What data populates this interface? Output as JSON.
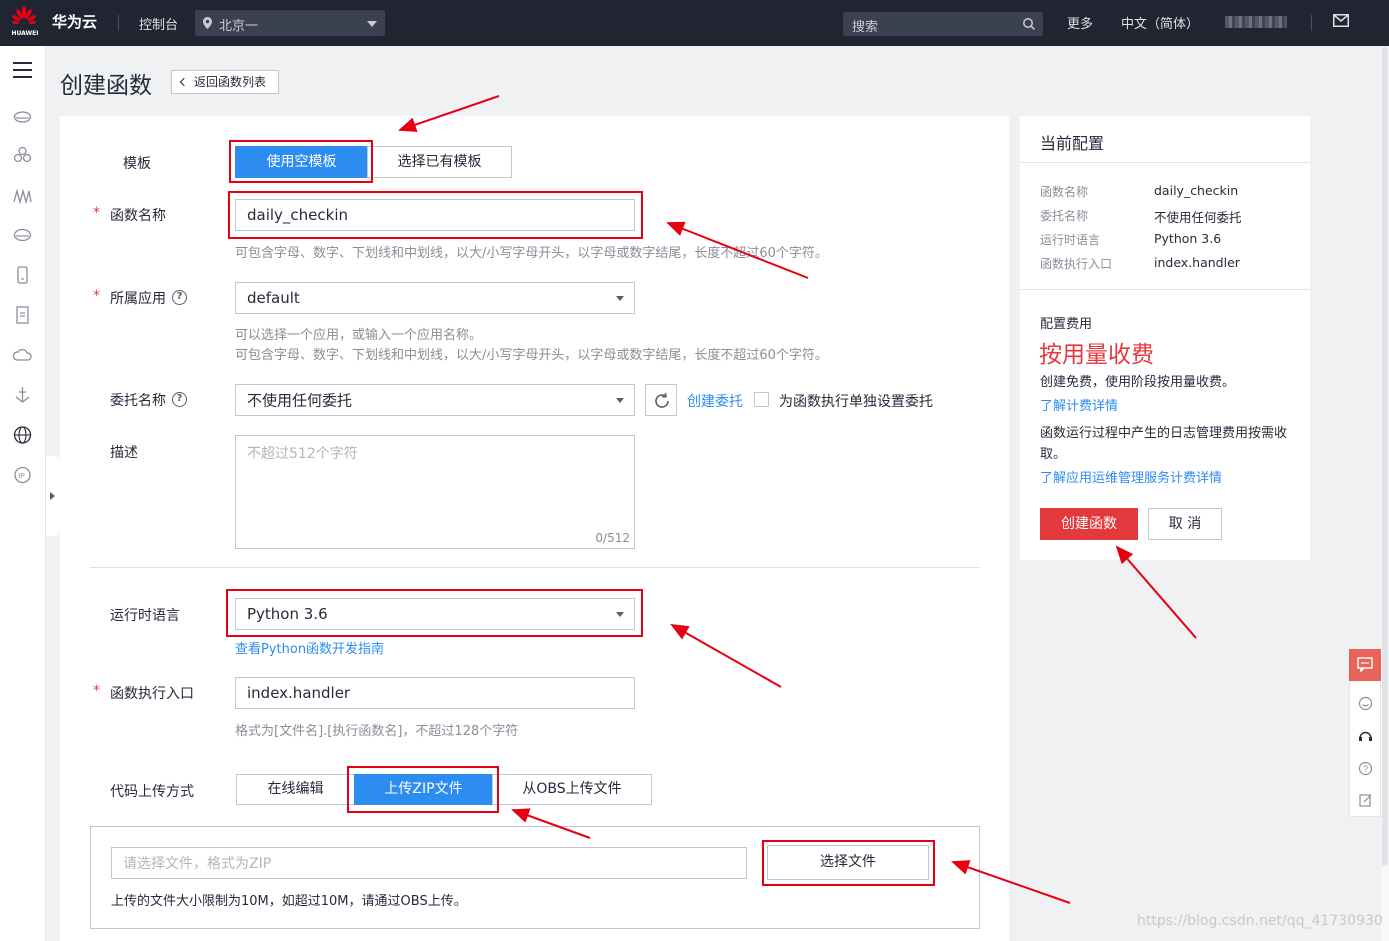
{
  "topbar": {
    "brand": "华为云",
    "logo_text": "HUAWEI",
    "console": "控制台",
    "region": "北京一",
    "search_placeholder": "搜索",
    "more": "更多",
    "language": "中文（简体）"
  },
  "page": {
    "title": "创建函数",
    "back_label": "返回函数列表"
  },
  "form": {
    "template_label": "模板",
    "template_options": [
      "使用空模板",
      "选择已有模板"
    ],
    "template_selected": "使用空模板",
    "func_name_label": "函数名称",
    "func_name_value": "daily_checkin",
    "func_name_hint": "可包含字母、数字、下划线和中划线，以大/小写字母开头，以字母或数字结尾，长度不超过60个字符。",
    "app_label": "所属应用",
    "app_value": "default",
    "app_hint_1": "可以选择一个应用，或输入一个应用名称。",
    "app_hint_2": "可包含字母、数字、下划线和中划线，以大/小写字母开头，以字母或数字结尾，长度不超过60个字符。",
    "agency_label": "委托名称",
    "agency_value": "不使用任何委托",
    "create_agency_link": "创建委托",
    "separate_agency_label": "为函数执行单独设置委托",
    "desc_label": "描述",
    "desc_placeholder": "不超过512个字符",
    "desc_counter": "0/512",
    "runtime_label": "运行时语言",
    "runtime_value": "Python 3.6",
    "runtime_guide_link": "查看Python函数开发指南",
    "handler_label": "函数执行入口",
    "handler_value": "index.handler",
    "handler_hint": "格式为[文件名].[执行函数名]，不超过128个字符",
    "upload_label": "代码上传方式",
    "upload_options": [
      "在线编辑",
      "上传ZIP文件",
      "从OBS上传文件"
    ],
    "upload_selected": "上传ZIP文件",
    "file_placeholder": "请选择文件，格式为ZIP",
    "choose_file_button": "选择文件",
    "upload_note": "上传的文件大小限制为10M，如超过10M，请通过OBS上传。"
  },
  "summary": {
    "title": "当前配置",
    "rows": [
      {
        "key": "函数名称",
        "value": "daily_checkin"
      },
      {
        "key": "委托名称",
        "value": "不使用任何委托"
      },
      {
        "key": "运行时语言",
        "value": "Python 3.6"
      },
      {
        "key": "函数执行入口",
        "value": "index.handler"
      }
    ],
    "fee_label": "配置费用",
    "fee_mode": "按用量收费",
    "fee_desc": "创建免费，使用阶段按用量收费。",
    "fee_link": "了解计费详情",
    "log_desc": "函数运行过程中产生的日志管理费用按需收取。",
    "log_link": "了解应用运维管理服务计费详情",
    "create_button": "创建函数",
    "cancel_button": "取 消"
  },
  "watermark": "https://blog.csdn.net/qq_41730930",
  "colors": {
    "topbar_bg": "#202531",
    "primary_blue": "#2d8cf0",
    "create_red": "#e4393c",
    "annotation_red": "#e60012"
  },
  "icons": [
    "huawei-logo-icon",
    "location-pin-icon",
    "search-icon",
    "mail-icon",
    "menu-icon",
    "refresh-icon",
    "help-icon",
    "chevron-left-icon",
    "chat-icon"
  ]
}
